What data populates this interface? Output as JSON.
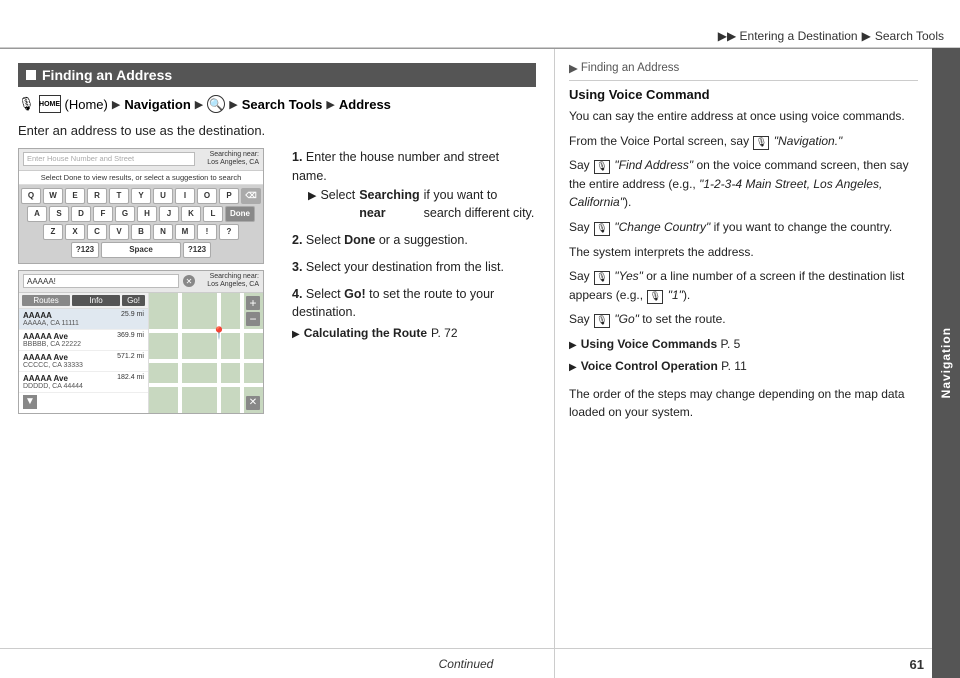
{
  "header": {
    "breadcrumb": "▶▶ Entering a Destination ▶ Search Tools",
    "part1": "▶▶ Entering a Destination",
    "arrow": "▶",
    "part2": "Search Tools"
  },
  "right_tab": {
    "label": "Navigation"
  },
  "left_section": {
    "heading": "Finding an Address",
    "nav_breadcrumb": {
      "mic": "🎙",
      "home_label": "HOME",
      "parts": [
        "(Home)",
        "Navigation",
        "Search Tools",
        "Address"
      ]
    },
    "subtitle": "Enter an address to use as the destination.",
    "keyboard_screen": {
      "search_placeholder": "Enter House Number and Street",
      "searching_near": "Searching near:\nLos Angeles, CA",
      "select_hint": "Select Done to view results, or select a suggestion to search",
      "rows": [
        [
          "Q",
          "W",
          "E",
          "R",
          "T",
          "Y",
          "U",
          "I",
          "O",
          "P",
          "⌫"
        ],
        [
          "A",
          "S",
          "D",
          "F",
          "G",
          "H",
          "J",
          "K",
          "L",
          "Done"
        ],
        [
          "Z",
          "X",
          "C",
          "V",
          "B",
          "N",
          "M",
          "!",
          "?"
        ],
        [
          "?123",
          "Space",
          "?123"
        ]
      ]
    },
    "map_screen": {
      "search_text": "AAAAA!",
      "searching_near": "Searching near:\nLos Angeles, CA",
      "results": [
        {
          "name": "AAAAA",
          "addr": "AAAAA, CA 11111",
          "dist": "25.9 mi"
        },
        {
          "name": "AAAAA Ave",
          "addr": "BBBBB, CA 22222",
          "dist": "369.9 mi"
        },
        {
          "name": "AAAAA Ave",
          "addr": "CCCCC, CA 33333",
          "dist": "571.2 mi"
        },
        {
          "name": "AAAAA Ave",
          "addr": "DDDDD, CA 44444",
          "dist": "182.4 mi"
        }
      ],
      "header_buttons": [
        "Routes",
        "Info",
        "Go!"
      ]
    },
    "steps": [
      {
        "num": "1.",
        "text": "Enter the house number and street name.",
        "sub": "Select Searching near if you want to search different city."
      },
      {
        "num": "2.",
        "text": "Select Done or a suggestion."
      },
      {
        "num": "3.",
        "text": "Select your destination from the list."
      },
      {
        "num": "4.",
        "text": "Select Go! to set the route to your destination.",
        "note": "Calculating the Route",
        "note_page": "P. 72"
      }
    ]
  },
  "right_section": {
    "breadcrumb": "▶ Finding an Address",
    "title": "Using Voice Command",
    "paragraphs": [
      "You can say the entire address at once using voice commands.",
      "From the Voice Portal screen, say  \"Navigation.\"",
      "Say  \"Find Address\"  on the voice command screen, then say the entire address (e.g., \"1-2-3-4 Main Street, Los Angeles, California\").",
      "Say  \"Change Country\"  if you want to change the country.",
      "The system interprets the address.",
      "Say  \"Yes\"  or a line number of a screen if the destination list appears (e.g.,  \"1\").",
      "Say  \"Go\"  to set the route."
    ],
    "links": [
      {
        "icon": "▶",
        "text": "Using Voice Commands",
        "page": "P. 5"
      },
      {
        "icon": "▶",
        "text": "Voice Control Operation",
        "page": "P. 11"
      }
    ],
    "final_note": "The order of the steps may change depending on the map data loaded on your system."
  },
  "footer": {
    "text": "Continued",
    "page_number": "61"
  }
}
